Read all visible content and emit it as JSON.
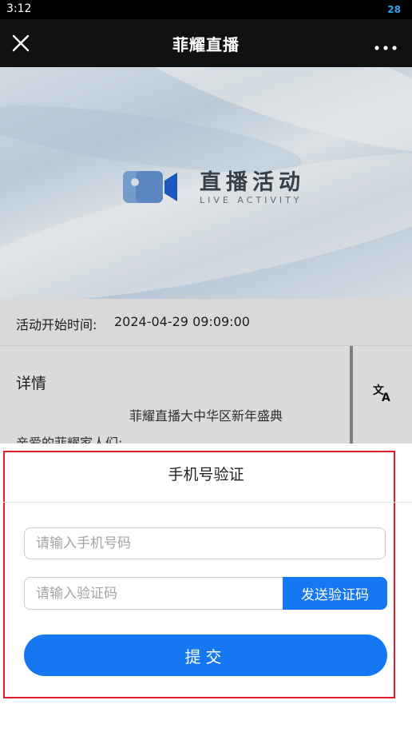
{
  "status_bar": {
    "time": "3:12",
    "battery": "28"
  },
  "header": {
    "title": "菲耀直播",
    "close_icon": "close-icon",
    "more_icon": "more-horizontal-icon"
  },
  "banner": {
    "title": "直播活动",
    "subtitle": "LIVE ACTIVITY",
    "icon": "video-camera-icon"
  },
  "event": {
    "start_label": "活动开始时间:",
    "start_value": "2024-04-29 09:09:00",
    "details_heading": "详情",
    "event_name": "菲耀直播大中华区新年盛典",
    "greeting": "亲爱的菲耀家人们:",
    "translate_icon": "translate-icon"
  },
  "verify_sheet": {
    "title": "手机号验证",
    "phone_placeholder": "请输入手机号码",
    "code_placeholder": "请输入验证码",
    "send_code_label": "发送验证码",
    "submit_label": "提交"
  },
  "colors": {
    "accent": "#1677f2",
    "highlight_border": "#e0202e",
    "header_bg": "#111111"
  }
}
